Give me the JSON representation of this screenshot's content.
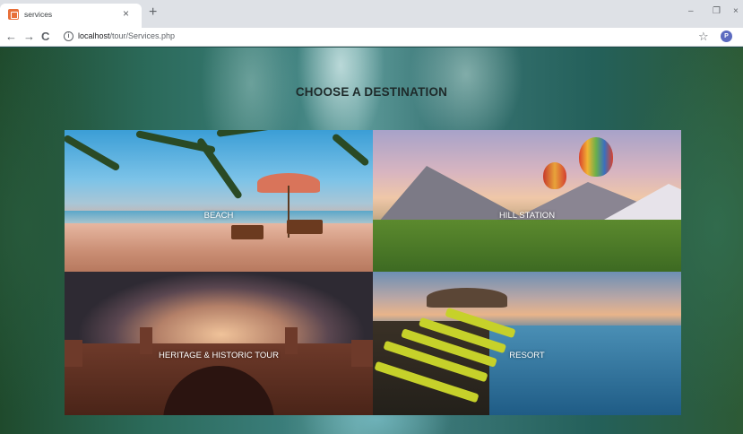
{
  "browser": {
    "tab": {
      "title": "services",
      "close_glyph": "×",
      "favicon": "tab-favicon-icon"
    },
    "new_tab_glyph": "+",
    "window_controls": {
      "minimize": "–",
      "maximize": "❐",
      "close": "×"
    },
    "nav": {
      "back": "←",
      "forward": "→",
      "reload": "C"
    },
    "address": {
      "info_glyph": "i",
      "host": "localhost",
      "path": "/tour/Services.php"
    },
    "bookmark_glyph": "☆",
    "profile_initial": "P"
  },
  "page": {
    "title": "CHOOSE A DESTINATION",
    "destinations": [
      {
        "label": "BEACH"
      },
      {
        "label": "HILL STATION"
      },
      {
        "label": "HERITAGE & HISTORIC TOUR"
      },
      {
        "label": "RESORT"
      }
    ]
  },
  "colors": {
    "tabstrip": "#dee1e6",
    "title_text": "#1e2a2a",
    "tile_label": "#ffffff",
    "favicon": "#e8703a",
    "profile_avatar": "#5c6bc0"
  }
}
